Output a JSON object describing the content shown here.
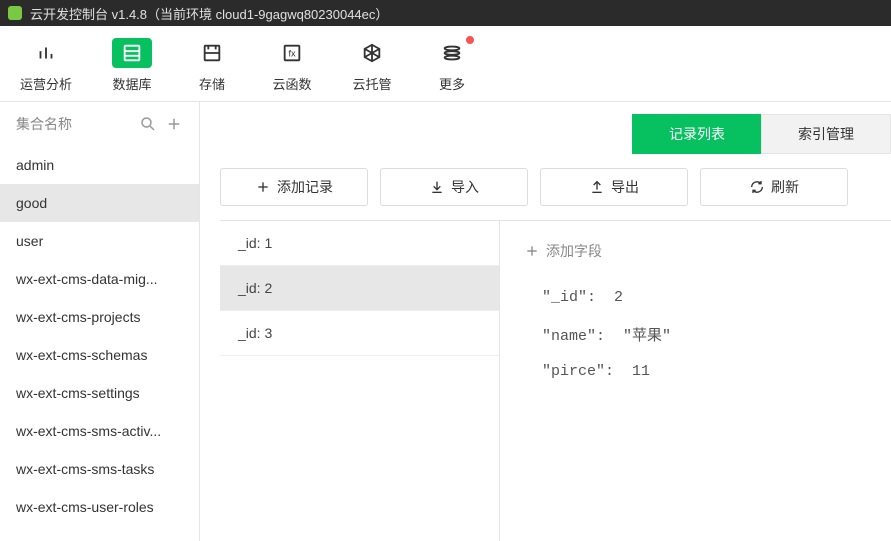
{
  "titlebar": {
    "text": "云开发控制台 v1.4.8（当前环境 cloud1-9gagwq80230044ec）"
  },
  "toolbar": {
    "items": [
      {
        "label": "运营分析"
      },
      {
        "label": "数据库"
      },
      {
        "label": "存储"
      },
      {
        "label": "云函数"
      },
      {
        "label": "云托管"
      },
      {
        "label": "更多"
      }
    ]
  },
  "sidebar": {
    "header": "集合名称",
    "items": [
      "admin",
      "good",
      "user",
      "wx-ext-cms-data-mig...",
      "wx-ext-cms-projects",
      "wx-ext-cms-schemas",
      "wx-ext-cms-settings",
      "wx-ext-cms-sms-activ...",
      "wx-ext-cms-sms-tasks",
      "wx-ext-cms-user-roles"
    ],
    "selected_index": 1
  },
  "tabs": {
    "items": [
      "记录列表",
      "索引管理"
    ],
    "active_index": 0
  },
  "actions": {
    "add_record": "添加记录",
    "import": "导入",
    "export": "导出",
    "refresh": "刷新"
  },
  "records": {
    "items": [
      "_id: 1",
      "_id: 2",
      "_id: 3"
    ],
    "selected_index": 1
  },
  "detail": {
    "add_field_label": "添加字段",
    "fields": [
      {
        "key": "\"_id\":",
        "value": "2"
      },
      {
        "key": "\"name\":",
        "value": "\"苹果\""
      },
      {
        "key": "\"pirce\":",
        "value": "11"
      }
    ]
  }
}
